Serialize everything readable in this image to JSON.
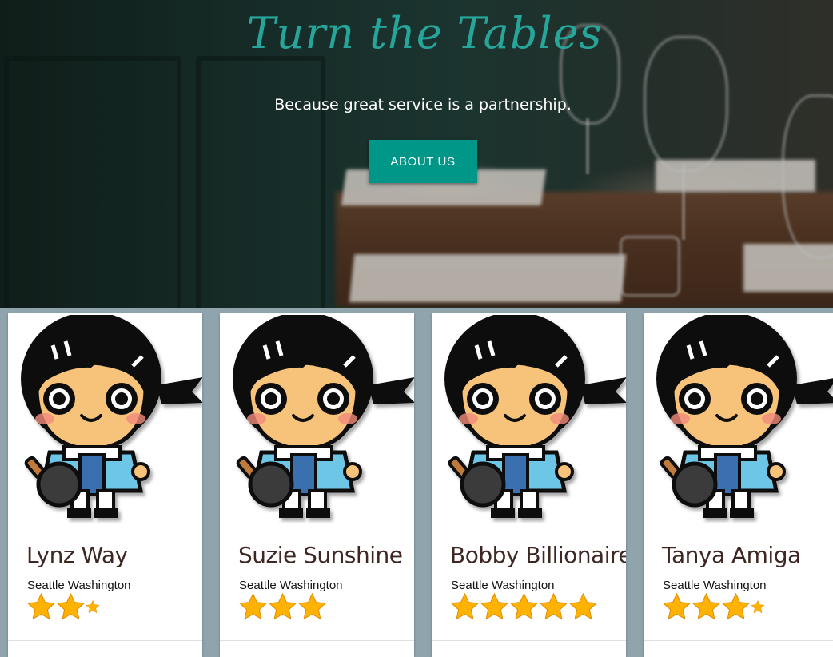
{
  "hero": {
    "title": "Turn the Tables",
    "subtitle": "Because great service is a partnership.",
    "about_label": "ABOUT US"
  },
  "colors": {
    "accent": "#26a69a",
    "button": "#009688",
    "cards_background": "#90a4ae",
    "star_fill": "#ffb300"
  },
  "servers": [
    {
      "name": "Lynz Way",
      "location": "Seattle Washington",
      "rating": 2.5
    },
    {
      "name": "Suzie Sunshine",
      "location": "Seattle Washington",
      "rating": 3
    },
    {
      "name": "Bobby Billionaire",
      "location": "Seattle Washington",
      "rating": 5
    },
    {
      "name": "Tanya Amiga",
      "location": "Seattle Washington",
      "rating": 3.5
    }
  ],
  "icons": {
    "avatar": "waiter-avatar-icon",
    "star": "star-icon"
  }
}
